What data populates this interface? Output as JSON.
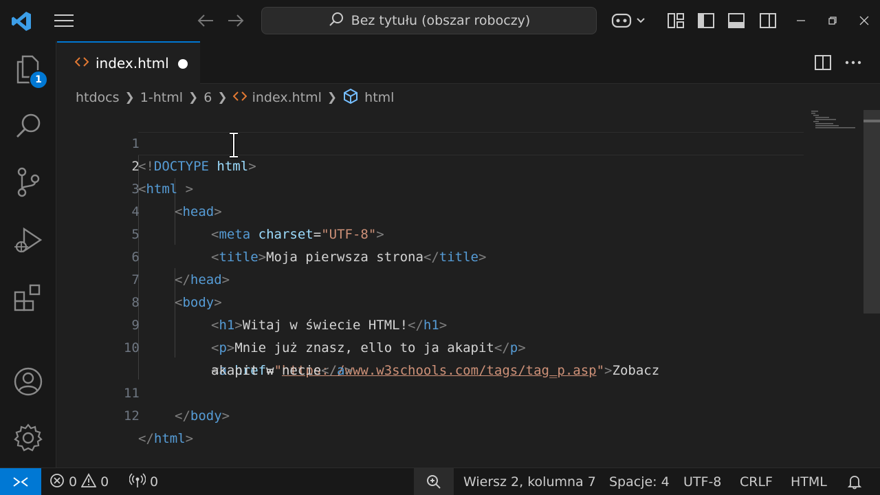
{
  "window": {
    "search_text": "Bez tytułu (obszar roboczy)"
  },
  "activity": {
    "explorer_badge": "1"
  },
  "tab": {
    "label": "index.html"
  },
  "breadcrumb": {
    "items": [
      "htdocs",
      "1-html",
      "6",
      "index.html",
      "html"
    ]
  },
  "editor": {
    "line_numbers": [
      "1",
      "2",
      "3",
      "4",
      "5",
      "6",
      "7",
      "8",
      "9",
      "10",
      "11",
      "12"
    ],
    "lines": {
      "l1": [
        "<!",
        "DOCTYPE",
        " ",
        "html",
        ">"
      ],
      "l2": [
        "<",
        "html",
        " >"
      ],
      "l3": [
        "<",
        "head",
        ">"
      ],
      "l4": [
        "<",
        "meta",
        " ",
        "charset",
        "=",
        "\"UTF-8\"",
        ">"
      ],
      "l5": [
        "<",
        "title",
        ">",
        "Moja pierwsza strona",
        "</",
        "title",
        ">"
      ],
      "l6": [
        "</",
        "head",
        ">"
      ],
      "l7": [
        "<",
        "body",
        ">"
      ],
      "l8": [
        "<",
        "h1",
        ">",
        "Witaj w świecie HTML!",
        "</",
        "h1",
        ">"
      ],
      "l9": [
        "<",
        "p",
        ">",
        "Mnie już znasz, ello to ja akapit",
        "</",
        "p",
        ">"
      ],
      "l10a": [
        "<",
        "a",
        " ",
        "href",
        "=",
        "\"",
        "https://www.w3schools.com/tags/tag_p.asp",
        "\"",
        ">",
        "Zobacz"
      ],
      "l10b": [
        "akapit w necie",
        "</",
        "a",
        ">"
      ],
      "l11": [
        "</",
        "body",
        ">"
      ],
      "l12": [
        "</",
        "html",
        ">"
      ]
    }
  },
  "status": {
    "errors": "0",
    "warnings": "0",
    "ports": "0",
    "position": "Wiersz 2, kolumna 7",
    "spaces": "Spacje: 4",
    "encoding": "UTF-8",
    "eol": "CRLF",
    "language": "HTML"
  },
  "colors": {
    "accent": "#0078d4",
    "tag": "#569cd6",
    "attribute": "#9cdcfe",
    "string": "#ce9178"
  }
}
